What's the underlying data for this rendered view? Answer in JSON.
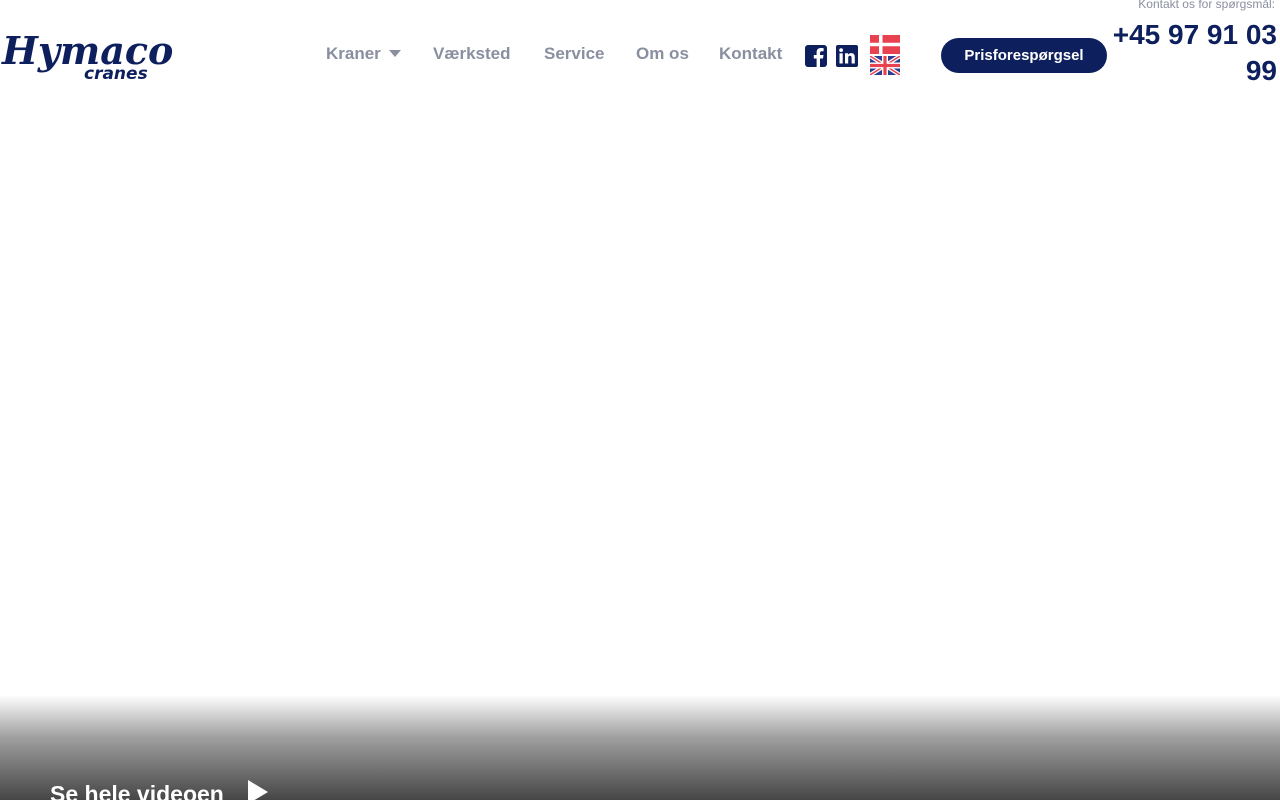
{
  "brand": {
    "logo_text": "Hymaco",
    "logo_subtext": "cranes",
    "color": "#0d1f5c"
  },
  "nav": {
    "items": [
      {
        "label": "Kraner",
        "has_dropdown": true
      },
      {
        "label": "Værksted"
      },
      {
        "label": "Service"
      },
      {
        "label": "Om os"
      },
      {
        "label": "Kontakt"
      }
    ]
  },
  "social": {
    "icons": [
      "facebook-icon",
      "linkedin-icon"
    ]
  },
  "languages": [
    "danish-flag-icon",
    "uk-flag-icon"
  ],
  "cta": {
    "label": "Prisforespørgsel"
  },
  "contact": {
    "label": "Kontakt os for spørgsmål:",
    "phone": "+45 97 91 03 99"
  },
  "hero": {
    "video_label": "Se hele videoen"
  },
  "colors": {
    "nav_text": "#8a8fa0",
    "accent": "#0d1f5c",
    "flag_red": "#e8414f"
  }
}
